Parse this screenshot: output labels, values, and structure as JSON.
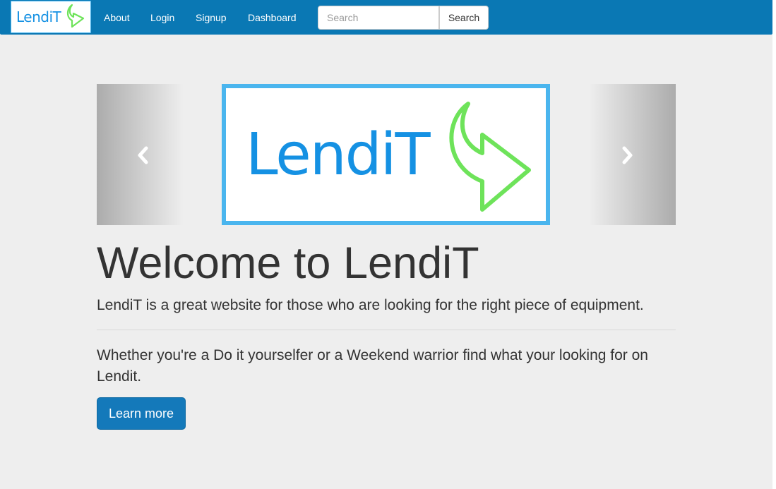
{
  "navbar": {
    "brand_text": "LendiT",
    "links": [
      "About",
      "Login",
      "Signup",
      "Dashboard"
    ],
    "search": {
      "placeholder": "Search",
      "value": "",
      "button_label": "Search"
    },
    "background_color": "#0a78b4"
  },
  "carousel": {
    "logo_text": "LendiT",
    "prev_icon": "chevron-left-icon",
    "next_icon": "chevron-right-icon"
  },
  "jumbotron": {
    "heading": "Welcome to LendiT",
    "lead": "LendiT is a great website for those who are looking for the right piece of equipment.",
    "body": "Whether you're a Do it yourselfer or a Weekend warrior find what your looking for on Lendit.",
    "button_label": "Learn more"
  },
  "colors": {
    "brand_blue": "#1591e3",
    "logo_border": "#4ab5ee",
    "arrow_green": "#6ee35a",
    "button_blue": "#1479ba",
    "page_background": "#eeeeee"
  }
}
